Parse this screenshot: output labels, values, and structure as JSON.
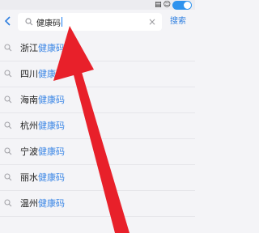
{
  "search": {
    "value": "健康码",
    "clear_icon": "×",
    "button_label": "搜索"
  },
  "suggestions": [
    {
      "prefix": "浙江",
      "highlight": "健康码"
    },
    {
      "prefix": "四川",
      "highlight": "健康码"
    },
    {
      "prefix": "海南",
      "highlight": "健康码"
    },
    {
      "prefix": "杭州",
      "highlight": "健康码"
    },
    {
      "prefix": "宁波",
      "highlight": "健康码"
    },
    {
      "prefix": "丽水",
      "highlight": "健康码"
    },
    {
      "prefix": "温州",
      "highlight": "健康码"
    }
  ],
  "colors": {
    "accent": "#2f7fe0",
    "highlight": "#3a86e6",
    "annotation_arrow": "#e8202a"
  },
  "icons": {
    "back": "chevron-left-icon",
    "search": "search-icon",
    "clear": "clear-icon",
    "suggestion": "search-icon"
  }
}
